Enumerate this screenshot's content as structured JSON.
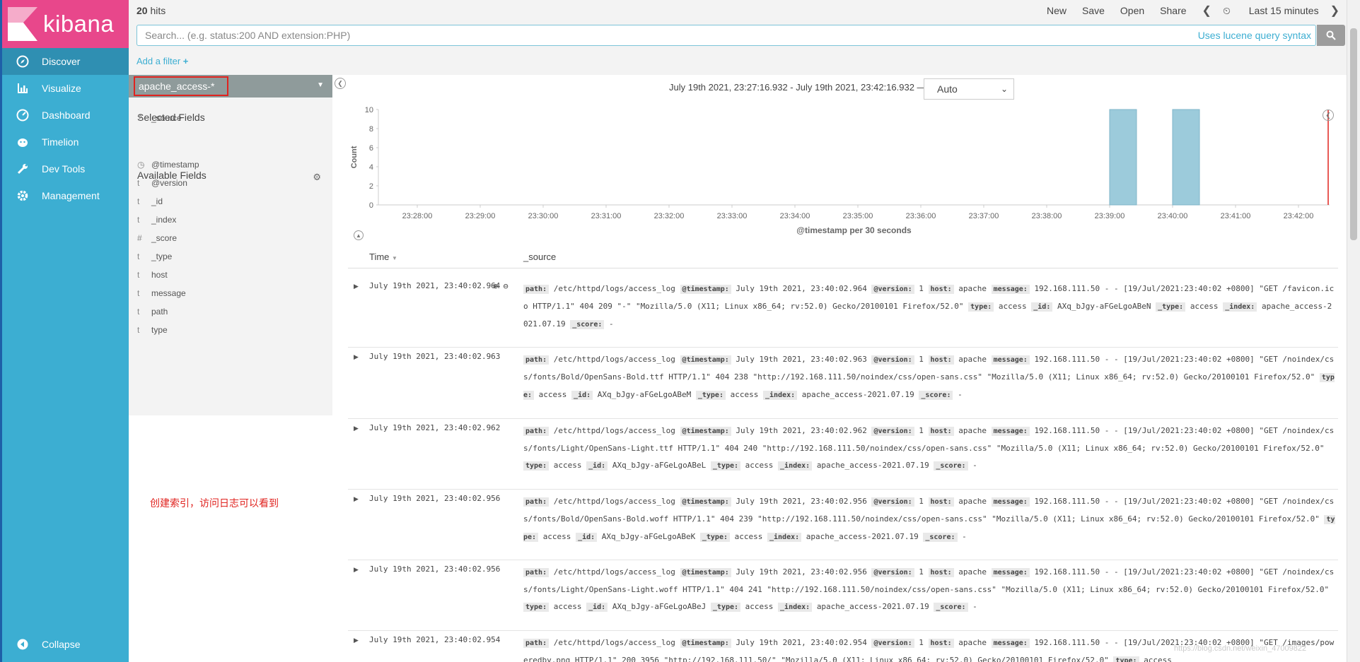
{
  "brand": "kibana",
  "nav": [
    {
      "label": "Discover",
      "icon": "compass-icon"
    },
    {
      "label": "Visualize",
      "icon": "bar-chart-icon"
    },
    {
      "label": "Dashboard",
      "icon": "dashboard-icon"
    },
    {
      "label": "Timelion",
      "icon": "timelion-icon"
    },
    {
      "label": "Dev Tools",
      "icon": "wrench-icon"
    },
    {
      "label": "Management",
      "icon": "gear-icon"
    }
  ],
  "collapse": "Collapse",
  "topbar": {
    "hits_count": "20",
    "hits_label": " hits",
    "new": "New",
    "save": "Save",
    "open": "Open",
    "share": "Share",
    "time": "Last 15 minutes"
  },
  "search": {
    "placeholder": "Search... (e.g. status:200 AND extension:PHP)",
    "lucene": "Uses lucene query syntax"
  },
  "add_filter": "Add a filter",
  "index_pattern": "apache_access-*",
  "selected_fields_title": "Selected Fields",
  "selected_fields": [
    {
      "type": "?",
      "name": "_source"
    }
  ],
  "available_fields_title": "Available Fields",
  "available_fields": [
    {
      "type": "◷",
      "name": "@timestamp"
    },
    {
      "type": "t",
      "name": "@version"
    },
    {
      "type": "t",
      "name": "_id"
    },
    {
      "type": "t",
      "name": "_index"
    },
    {
      "type": "#",
      "name": "_score"
    },
    {
      "type": "t",
      "name": "_type"
    },
    {
      "type": "t",
      "name": "host"
    },
    {
      "type": "t",
      "name": "message"
    },
    {
      "type": "t",
      "name": "path"
    },
    {
      "type": "t",
      "name": "type"
    }
  ],
  "annotation": "创建索引，访问日志可以看到",
  "time_range": "July 19th 2021, 23:27:16.932 - July 19th 2021, 23:42:16.932 —",
  "interval": "Auto",
  "chart_data": {
    "type": "bar",
    "ylabel": "Count",
    "xlabel": "@timestamp per 30 seconds",
    "ylim": [
      0,
      10
    ],
    "yticks": [
      0,
      2,
      4,
      6,
      8,
      10
    ],
    "xticks": [
      "23:28:00",
      "23:29:00",
      "23:30:00",
      "23:31:00",
      "23:32:00",
      "23:33:00",
      "23:34:00",
      "23:35:00",
      "23:36:00",
      "23:37:00",
      "23:38:00",
      "23:39:00",
      "23:40:00",
      "23:41:00",
      "23:42:00"
    ],
    "bars": [
      {
        "x": "23:39:00",
        "value": 10
      },
      {
        "x": "23:40:00",
        "value": 10
      }
    ]
  },
  "table": {
    "col_time": "Time",
    "col_source": "_source"
  },
  "rows": [
    {
      "time": "July 19th 2021, 23:40:02.964",
      "path": "/etc/httpd/logs/access_log",
      "timestamp": "July 19th 2021, 23:40:02.964",
      "version": "1",
      "host": "apache",
      "message": "192.168.111.50 - - [19/Jul/2021:23:40:02 +0800] \"GET /favicon.ico HTTP/1.1\" 404 209 \"-\" \"Mozilla/5.0 (X11; Linux x86_64; rv:52.0) Gecko/20100101 Firefox/52.0\"",
      "type": "access",
      "id": "AXq_bJgy-aFGeLgoABeN",
      "index": "apache_access-2021.07.19",
      "score": "-"
    },
    {
      "time": "July 19th 2021, 23:40:02.963",
      "path": "/etc/httpd/logs/access_log",
      "timestamp": "July 19th 2021, 23:40:02.963",
      "version": "1",
      "host": "apache",
      "message": "192.168.111.50 - - [19/Jul/2021:23:40:02 +0800] \"GET /noindex/css/fonts/Bold/OpenSans-Bold.ttf HTTP/1.1\" 404 238 \"http://192.168.111.50/noindex/css/open-sans.css\" \"Mozilla/5.0 (X11; Linux x86_64; rv:52.0) Gecko/20100101 Firefox/52.0\"",
      "type": "access",
      "id": "AXq_bJgy-aFGeLgoABeM",
      "index": "apache_access-2021.07.19",
      "score": "-"
    },
    {
      "time": "July 19th 2021, 23:40:02.962",
      "path": "/etc/httpd/logs/access_log",
      "timestamp": "July 19th 2021, 23:40:02.962",
      "version": "1",
      "host": "apache",
      "message": "192.168.111.50 - - [19/Jul/2021:23:40:02 +0800] \"GET /noindex/css/fonts/Light/OpenSans-Light.ttf HTTP/1.1\" 404 240 \"http://192.168.111.50/noindex/css/open-sans.css\" \"Mozilla/5.0 (X11; Linux x86_64; rv:52.0) Gecko/20100101 Firefox/52.0\"",
      "type": "access",
      "id": "AXq_bJgy-aFGeLgoABeL",
      "index": "apache_access-2021.07.19",
      "score": "-"
    },
    {
      "time": "July 19th 2021, 23:40:02.956",
      "path": "/etc/httpd/logs/access_log",
      "timestamp": "July 19th 2021, 23:40:02.956",
      "version": "1",
      "host": "apache",
      "message": "192.168.111.50 - - [19/Jul/2021:23:40:02 +0800] \"GET /noindex/css/fonts/Bold/OpenSans-Bold.woff HTTP/1.1\" 404 239 \"http://192.168.111.50/noindex/css/open-sans.css\" \"Mozilla/5.0 (X11; Linux x86_64; rv:52.0) Gecko/20100101 Firefox/52.0\"",
      "type": "access",
      "id": "AXq_bJgy-aFGeLgoABeK",
      "index": "apache_access-2021.07.19",
      "score": "-"
    },
    {
      "time": "July 19th 2021, 23:40:02.956",
      "path": "/etc/httpd/logs/access_log",
      "timestamp": "July 19th 2021, 23:40:02.956",
      "version": "1",
      "host": "apache",
      "message": "192.168.111.50 - - [19/Jul/2021:23:40:02 +0800] \"GET /noindex/css/fonts/Light/OpenSans-Light.woff HTTP/1.1\" 404 241 \"http://192.168.111.50/noindex/css/open-sans.css\" \"Mozilla/5.0 (X11; Linux x86_64; rv:52.0) Gecko/20100101 Firefox/52.0\"",
      "type": "access",
      "id": "AXq_bJgy-aFGeLgoABeJ",
      "index": "apache_access-2021.07.19",
      "score": "-"
    },
    {
      "time": "July 19th 2021, 23:40:02.954",
      "path": "/etc/httpd/logs/access_log",
      "timestamp": "July 19th 2021, 23:40:02.954",
      "version": "1",
      "host": "apache",
      "message": "192.168.111.50 - - [19/Jul/2021:23:40:02 +0800] \"GET /images/poweredby.png HTTP/1.1\" 200 3956 \"http://192.168.111.50/\" \"Mozilla/5.0 (X11; Linux x86_64; rv:52.0) Gecko/20100101 Firefox/52.0\"",
      "type": "access",
      "id": "",
      "index": "",
      "score": ""
    }
  ],
  "field_keys": {
    "path": "path:",
    "timestamp": "@timestamp:",
    "version": "@version:",
    "host": "host:",
    "message": "message:",
    "type": "type:",
    "id": "_id:",
    "itype": "_type:",
    "index": "_index:",
    "score": "_score:"
  },
  "itype_value": "access",
  "watermark": "https://blog.csdn.net/weixin_47009822"
}
